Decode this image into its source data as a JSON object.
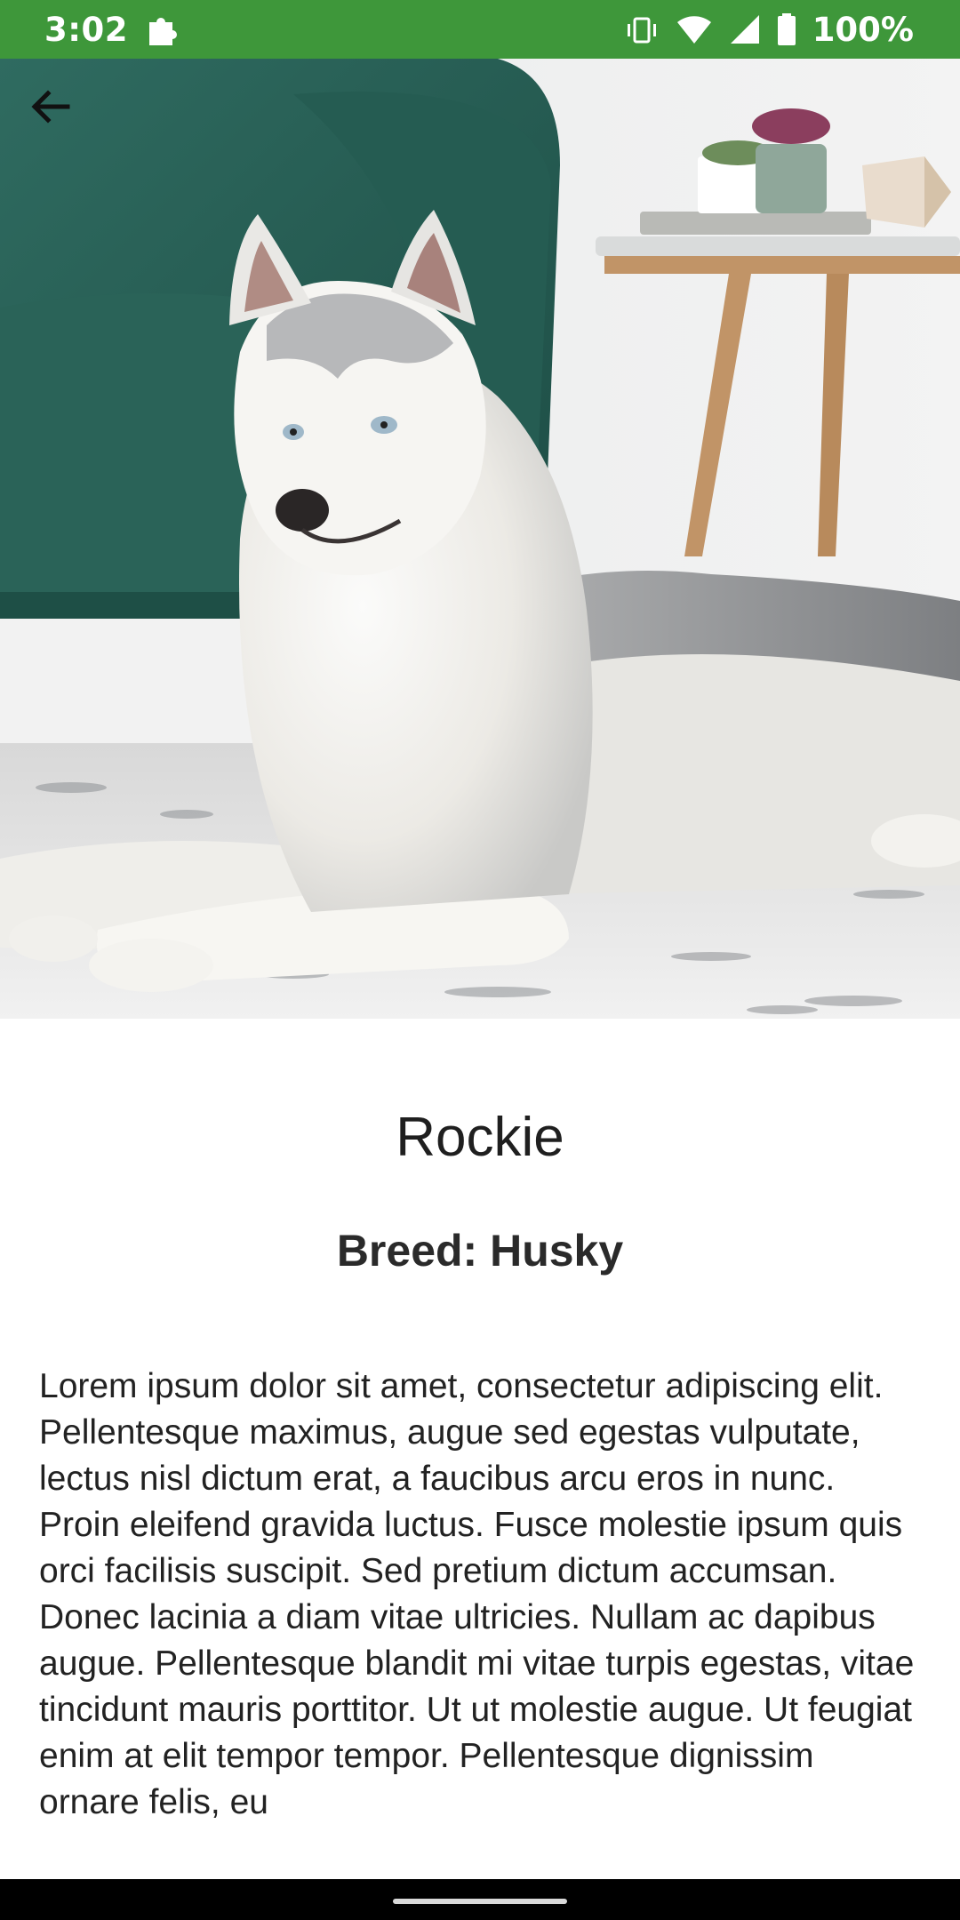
{
  "status_bar": {
    "time": "3:02",
    "battery": "100%",
    "icons": [
      "puzzle-icon",
      "vibrate-icon",
      "wifi-icon",
      "signal-icon",
      "battery-icon"
    ],
    "background": "#3e973a"
  },
  "hero": {
    "image": "husky-photo",
    "back_icon": "arrow-back-icon"
  },
  "dog": {
    "name": "Rockie",
    "breed": "Breed: Husky",
    "description": "Lorem ipsum dolor sit amet, consectetur adipiscing elit. Pellentesque maximus, augue sed egestas vulputate, lectus nisl dictum erat, a faucibus arcu eros in nunc. Proin eleifend gravida luctus. Fusce molestie ipsum quis orci facilisis suscipit. Sed pretium dictum accumsan. Donec lacinia a diam vitae ultricies. Nullam ac dapibus augue. Pellentesque blandit mi vitae turpis egestas, vitae tincidunt mauris porttitor. Ut ut molestie augue. Ut feugiat enim at elit tempor tempor. Pellentesque dignissim ornare felis, eu"
  }
}
